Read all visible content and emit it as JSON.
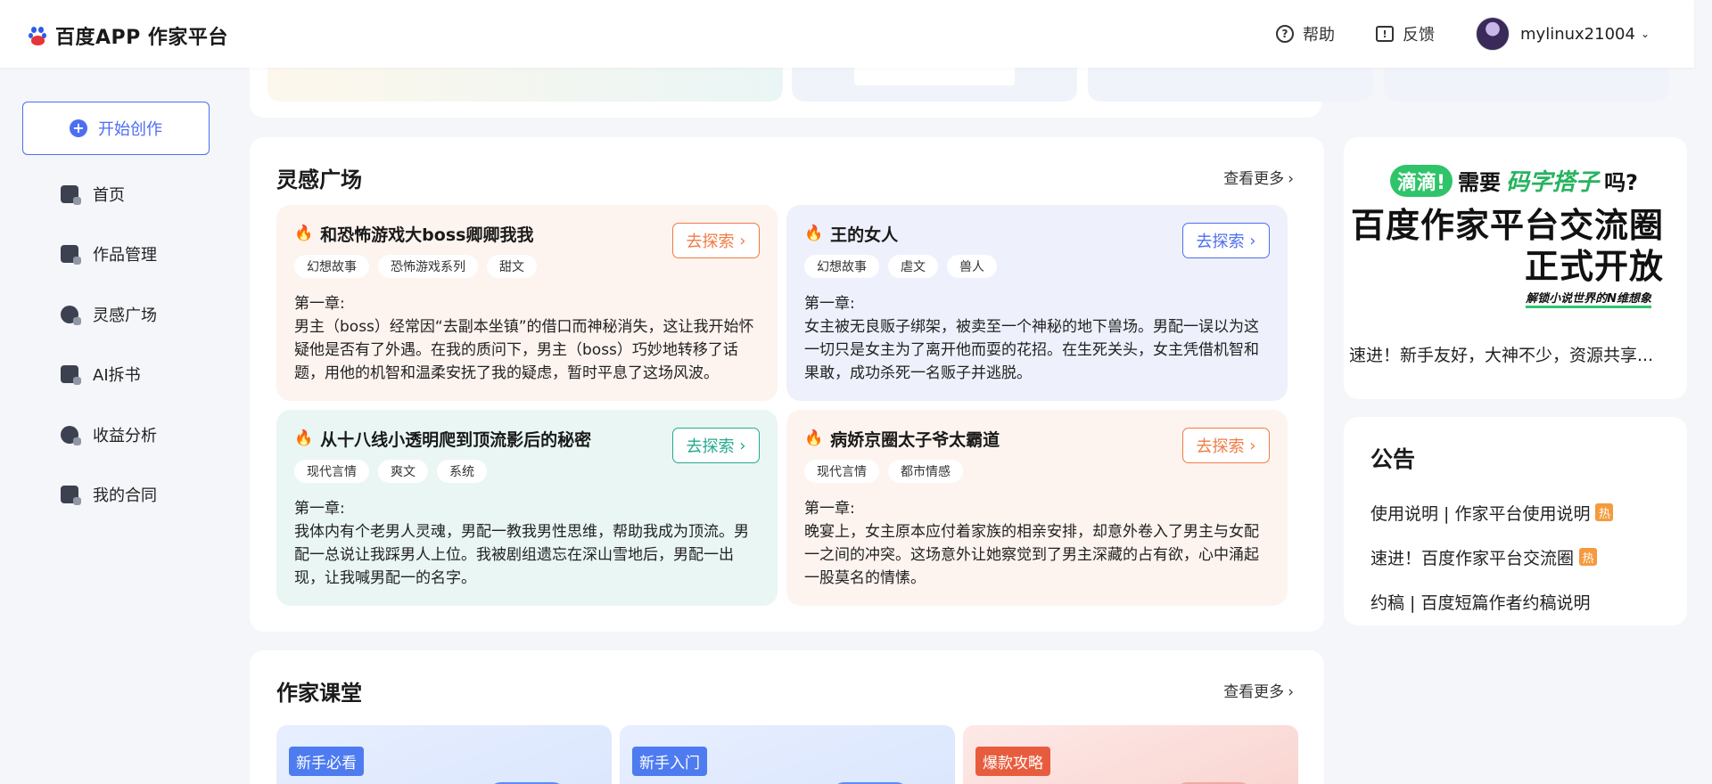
{
  "header": {
    "brand": "百度APP 作家平台",
    "help": "帮助",
    "feedback": "反馈",
    "username": "mylinux21004"
  },
  "sidebar": {
    "start_label": "开始创作",
    "items": [
      {
        "label": "首页",
        "icon": "home-icon"
      },
      {
        "label": "作品管理",
        "icon": "works-icon"
      },
      {
        "label": "灵感广场",
        "icon": "bulb-icon"
      },
      {
        "label": "AI拆书",
        "icon": "ai-book-icon"
      },
      {
        "label": "收益分析",
        "icon": "income-icon"
      },
      {
        "label": "我的合同",
        "icon": "contract-icon"
      }
    ]
  },
  "inspiration": {
    "title": "灵感广场",
    "more": "查看更多",
    "explore_label": "去探索",
    "cards": [
      {
        "title": "和恐怖游戏大boss卿卿我我",
        "tags": [
          "幻想故事",
          "恐怖游戏系列",
          "甜文"
        ],
        "chapter": "第一章:",
        "desc": "男主（boss）经常因“去副本坐镇”的借口而神秘消失，这让我开始怀疑他是否有了外遇。在我的质问下，男主（boss）巧妙地转移了话题，用他的机智和温柔安抚了我的疑虑，暂时平息了这场风波。"
      },
      {
        "title": "王的女人",
        "tags": [
          "幻想故事",
          "虐文",
          "兽人"
        ],
        "chapter": "第一章:",
        "desc": "女主被无良贩子绑架，被卖至一个神秘的地下兽场。男配一误以为这一切只是女主为了离开他而耍的花招。在生死关头，女主凭借机智和果敢，成功杀死一名贩子并逃脱。"
      },
      {
        "title": "从十八线小透明爬到顶流影后的秘密",
        "tags": [
          "现代言情",
          "爽文",
          "系统"
        ],
        "chapter": "第一章:",
        "desc": "我体内有个老男人灵魂，男配一教我男性思维，帮助我成为顶流。男配一总说让我踩男人上位。我被剧组遗忘在深山雪地后，男配一出现，让我喊男配一的名字。"
      },
      {
        "title": "病娇京圈太子爷太霸道",
        "tags": [
          "现代言情",
          "都市情感"
        ],
        "chapter": "第一章:",
        "desc": "晚宴上，女主原本应付着家族的相亲安排，却意外卷入了男主与女配一之间的冲突。这场意外让她察觉到了男主深藏的占有欲，心中涌起一股莫名的情愫。"
      }
    ]
  },
  "classroom": {
    "title": "作家课堂",
    "more": "查看更多",
    "tags": [
      "新手必看",
      "新手入门",
      "爆款攻略"
    ]
  },
  "promo": {
    "pill": "滴滴!",
    "need": "需要",
    "typist": "码字搭子",
    "question": "吗?",
    "big_line1": "百度作家平台交流圈",
    "big_line2": "正式开放",
    "sub": "解锁小说世界的N维想象",
    "desc": "速进！新手友好，大神不少，资源共享..."
  },
  "notice": {
    "title": "公告",
    "hot_label": "热",
    "items": [
      {
        "text": "使用说明 | 作家平台使用说明",
        "hot": true
      },
      {
        "text": "速进！百度作家平台交流圈",
        "hot": true
      },
      {
        "text": "约稿 | 百度短篇作者约稿说明",
        "hot": false
      }
    ]
  }
}
